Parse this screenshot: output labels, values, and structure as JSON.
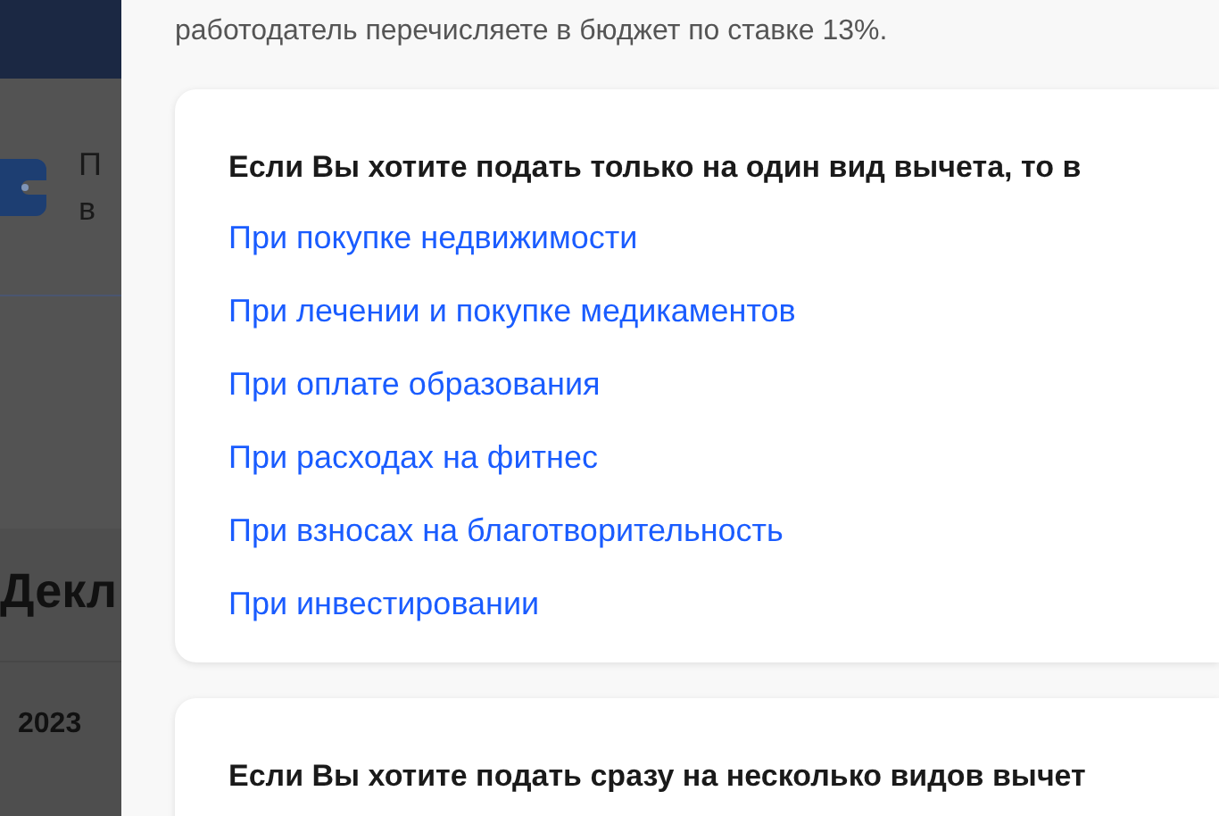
{
  "background_page": {
    "header_letters": [
      "П",
      "в"
    ],
    "heading": "Декл",
    "year_tab": "2023"
  },
  "drawer": {
    "intro_tail": "работодатель перечисляете в бюджет по ставке 13%.",
    "cards": [
      {
        "heading": "Если Вы хотите подать только на один вид вычета, то в",
        "links": [
          "При покупке недвижимости",
          "При лечении и покупке медикаментов",
          "При оплате образования",
          "При расходах на фитнес",
          "При взносах на благотворительность",
          "При инвестировании"
        ]
      },
      {
        "heading": "Если Вы хотите подать сразу на несколько видов вычет"
      }
    ]
  }
}
